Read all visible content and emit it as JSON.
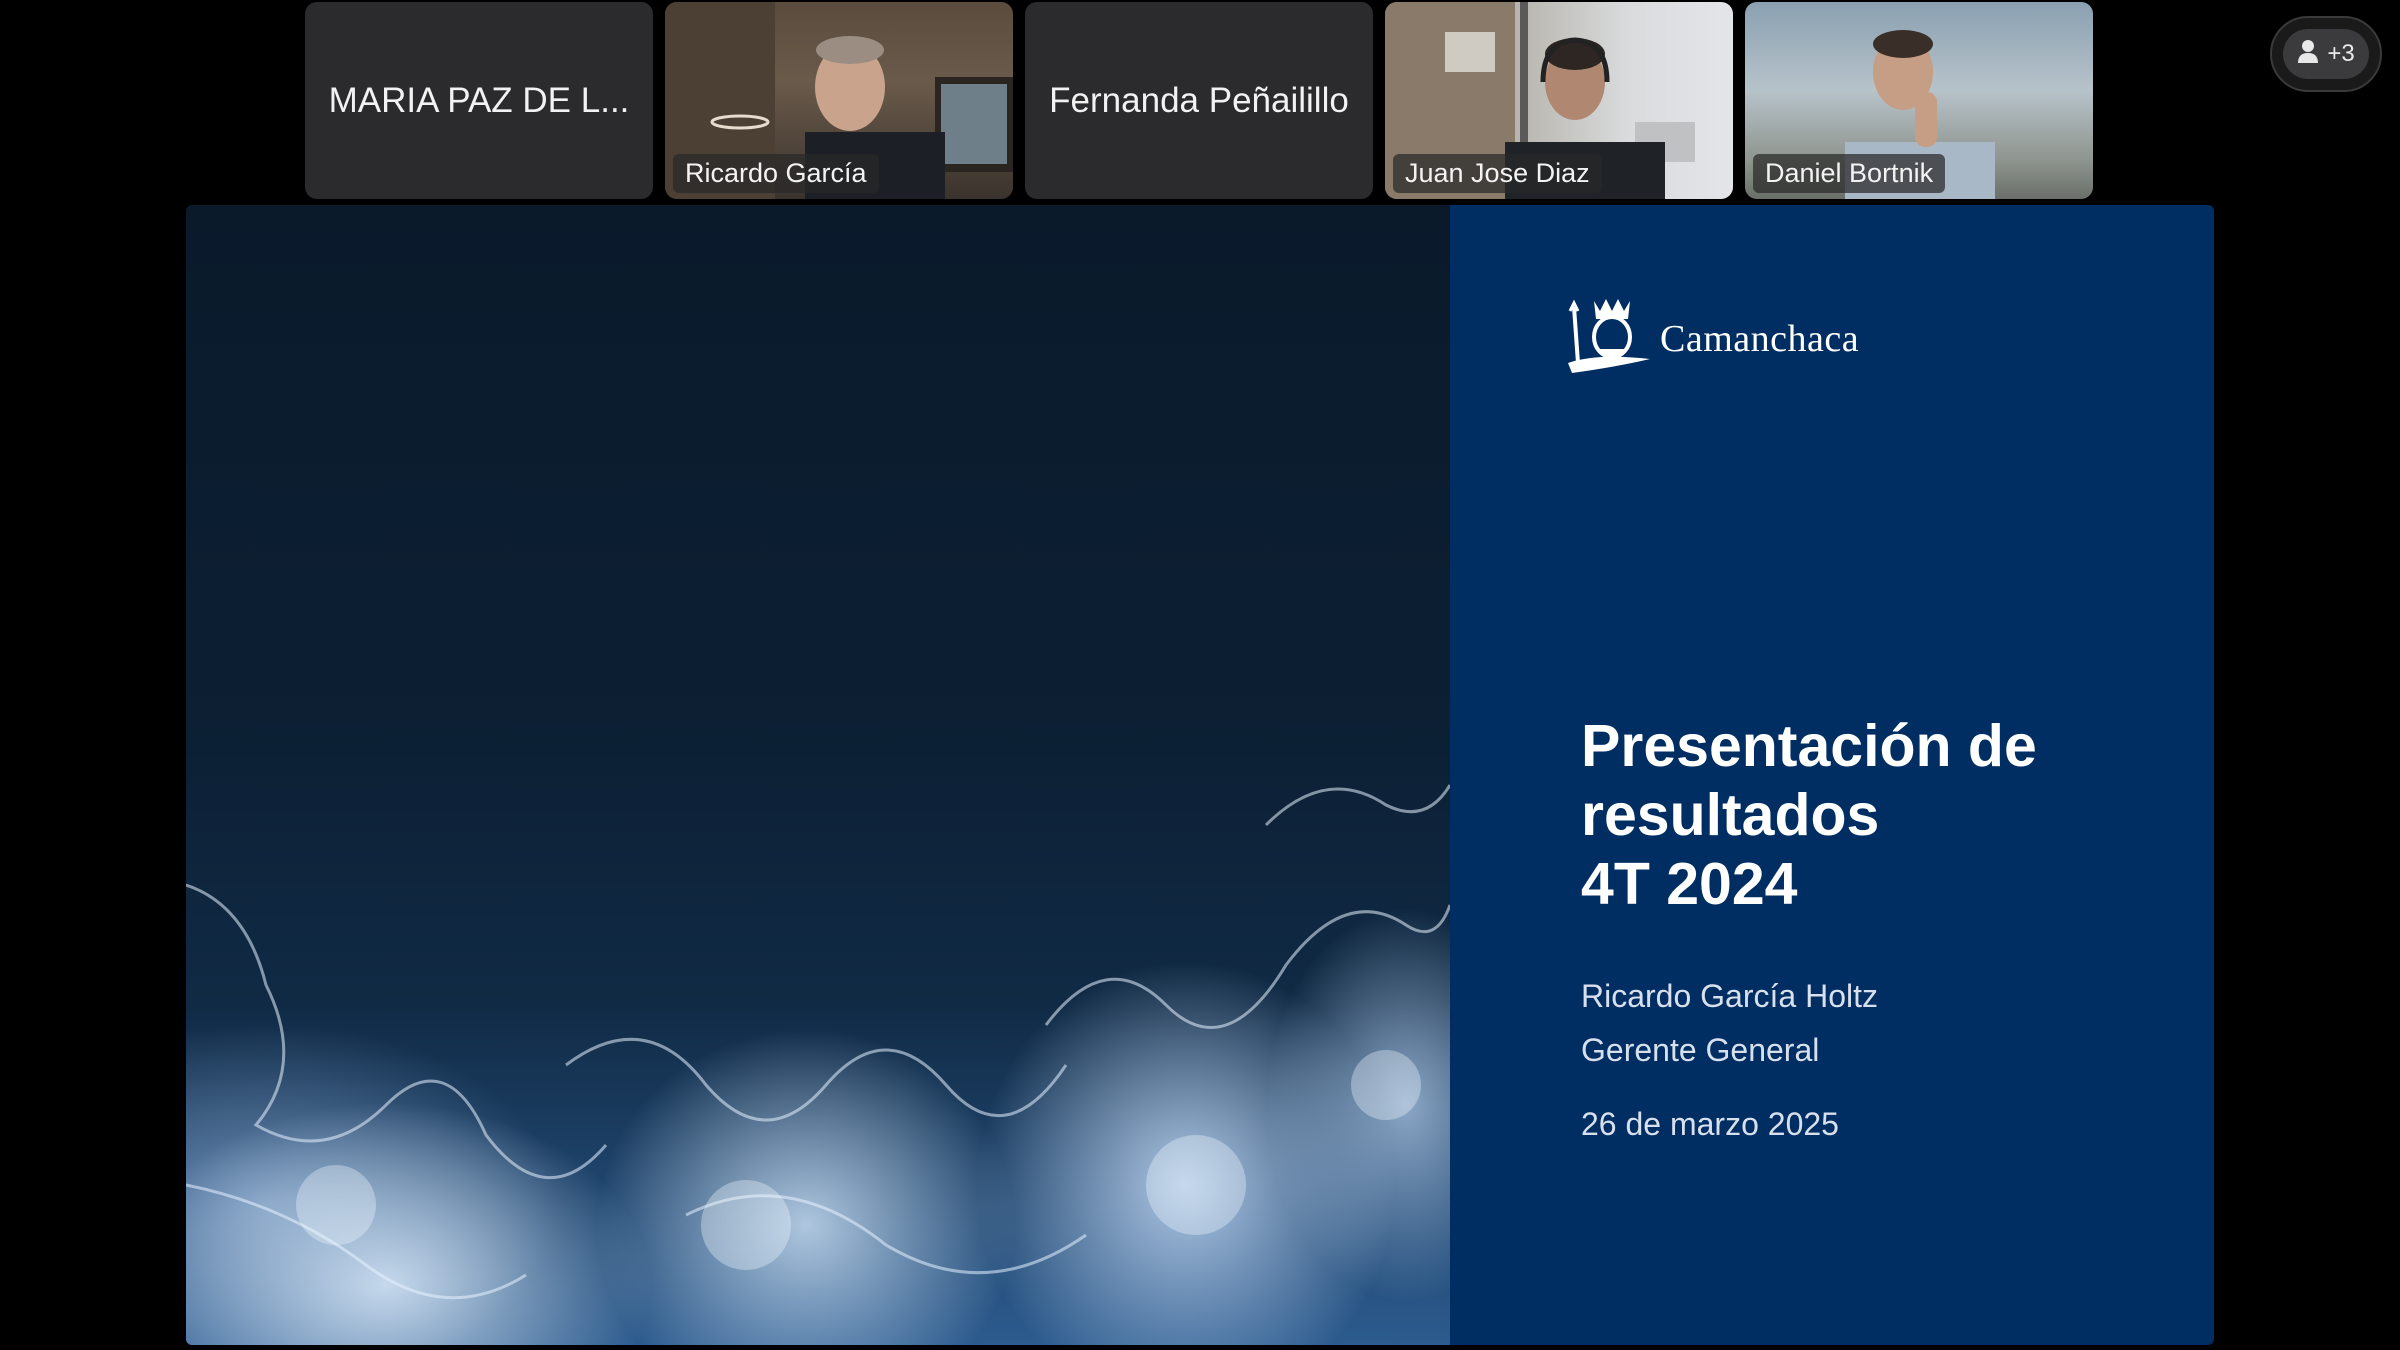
{
  "participants": [
    {
      "name": "MARIA PAZ DE L...",
      "video": false
    },
    {
      "name": "Ricardo García",
      "video": true
    },
    {
      "name": "Fernanda Peñailillo",
      "video": false
    },
    {
      "name": "Juan Jose Diaz",
      "video": true
    },
    {
      "name": "Daniel Bortnik",
      "video": true
    }
  ],
  "overflow": {
    "label": "+3",
    "icon": "person-icon"
  },
  "slide": {
    "logo_text": "Camanchaca",
    "logo_icon": "camanchaca-crest-icon",
    "title_lines": [
      "Presentación de",
      "resultados",
      "4T 2024"
    ],
    "presenter": "Ricardo García Holtz",
    "role": "Gerente General",
    "date": "26 de marzo 2025"
  },
  "colors": {
    "background": "#000000",
    "tile": "#2b2b2d",
    "slide_panel": "#002d62"
  }
}
